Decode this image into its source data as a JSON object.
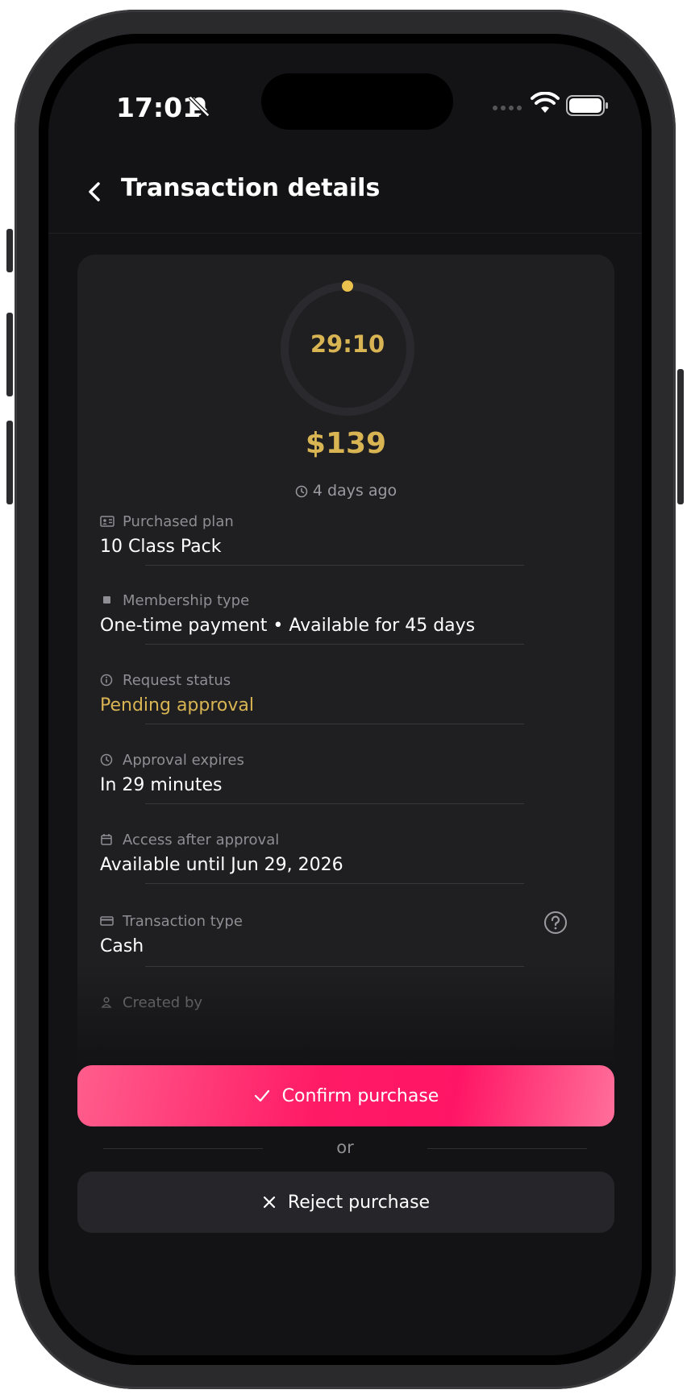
{
  "status_bar": {
    "time": "17:01"
  },
  "header": {
    "title": "Transaction details"
  },
  "summary": {
    "timer": "29:10",
    "timer_remaining_fraction": 0.97,
    "amount": "$139",
    "ago": "4 days ago"
  },
  "details": [
    {
      "icon": "id-card-icon",
      "label": "Purchased plan",
      "value": "10 Class Pack"
    },
    {
      "icon": "square-icon",
      "label": "Membership type",
      "value": "One-time payment • Available for 45 days"
    },
    {
      "icon": "info-icon",
      "label": "Request status",
      "value": "Pending approval"
    },
    {
      "icon": "clock-icon",
      "label": "Approval expires",
      "value": "In 29 minutes"
    },
    {
      "icon": "calendar-icon",
      "label": "Access after approval",
      "value": "Available until Jun 29, 2026"
    },
    {
      "icon": "credit-card-icon",
      "label": "Transaction type",
      "value": "Cash"
    },
    {
      "icon": "user-icon",
      "label": "Created by",
      "value": ""
    }
  ],
  "actions": {
    "confirm_label": "Confirm purchase",
    "or_label": "or",
    "reject_label": "Reject purchase"
  },
  "colors": {
    "accent_gold": "#d9b453",
    "confirm_pink": "#ff1a66",
    "background": "#131315",
    "card": "#1f1f22"
  }
}
